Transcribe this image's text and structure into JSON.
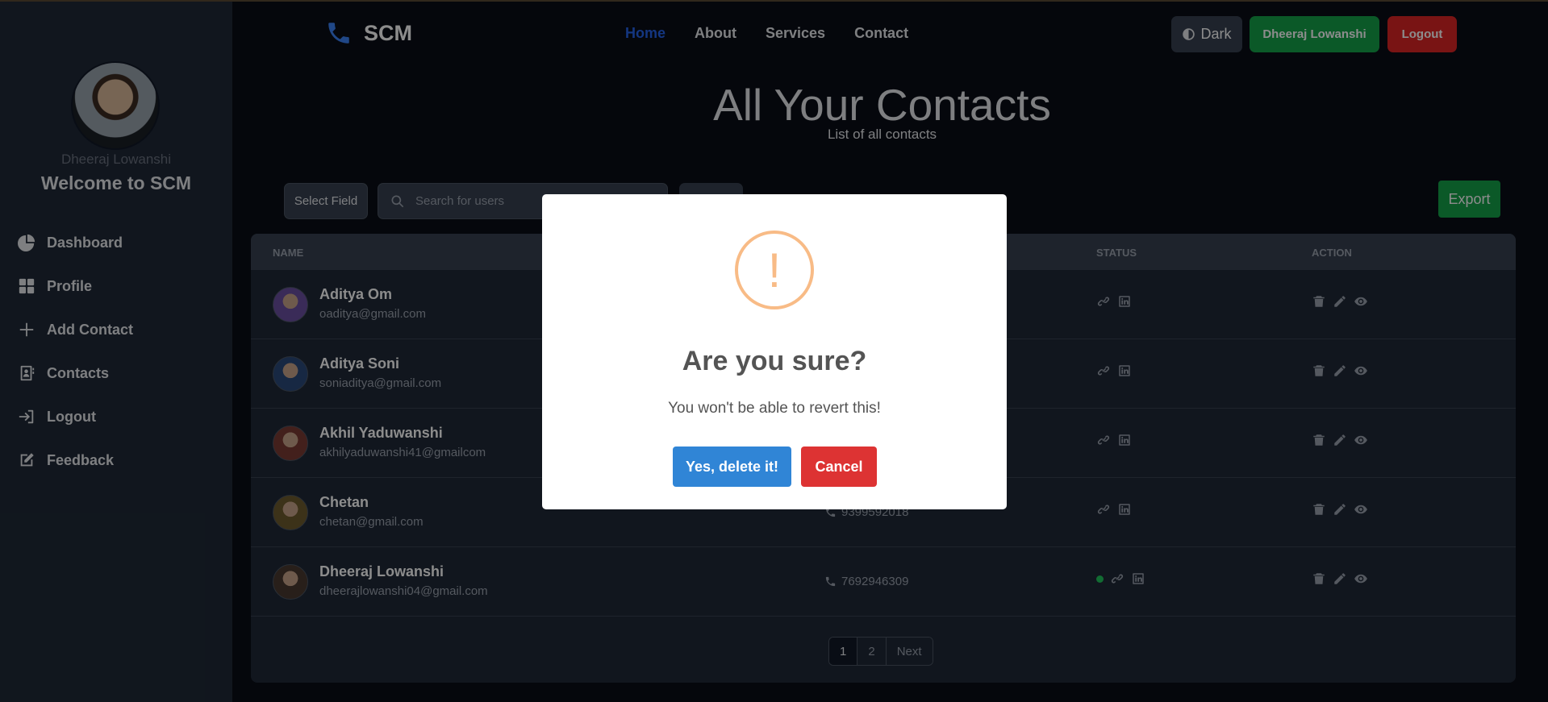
{
  "sidebar": {
    "username": "Dheeraj Lowanshi",
    "welcome": "Welcome to SCM",
    "items": [
      {
        "label": "Dashboard",
        "icon": "pie-chart-icon"
      },
      {
        "label": "Profile",
        "icon": "grid-icon"
      },
      {
        "label": "Add Contact",
        "icon": "plus-icon"
      },
      {
        "label": "Contacts",
        "icon": "address-book-icon"
      },
      {
        "label": "Logout",
        "icon": "sign-in-icon"
      },
      {
        "label": "Feedback",
        "icon": "edit-icon"
      }
    ]
  },
  "navbar": {
    "brand": "SCM",
    "links": [
      "Home",
      "About",
      "Services",
      "Contact"
    ],
    "active": "Home",
    "dark_label": "Dark",
    "user_label": "Dheeraj Lowanshi",
    "logout_label": "Logout"
  },
  "page": {
    "title": "All Your Contacts",
    "subtitle": "List of all contacts"
  },
  "filters": {
    "select_label": "Select Field",
    "search_placeholder": "Search for users",
    "export_label": "Export"
  },
  "table": {
    "headers": {
      "name": "NAME",
      "status": "STATUS",
      "action": "ACTION"
    },
    "rows": [
      {
        "name": "Aditya Om",
        "email": "oaditya@gmail.com",
        "phone": "",
        "favorite": false,
        "avatar_color": "#6b4fa0"
      },
      {
        "name": "Aditya Soni",
        "email": "soniaditya@gmail.com",
        "phone": "",
        "favorite": false,
        "avatar_color": "#2b4a7a"
      },
      {
        "name": "Akhil Yaduwanshi",
        "email": "akhilyaduwanshi41@gmailcom",
        "phone": "",
        "favorite": false,
        "avatar_color": "#7a3b34"
      },
      {
        "name": "Chetan",
        "email": "chetan@gmail.com",
        "phone": "9399592018",
        "favorite": false,
        "avatar_color": "#6e5b2e"
      },
      {
        "name": "Dheeraj Lowanshi",
        "email": "dheerajlowanshi04@gmail.com",
        "phone": "7692946309",
        "favorite": true,
        "avatar_color": "#4a3a30"
      }
    ]
  },
  "pagination": {
    "pages": [
      "1",
      "2"
    ],
    "next": "Next",
    "current": "1"
  },
  "modal": {
    "icon": "!",
    "title": "Are you sure?",
    "text": "You won't be able to revert this!",
    "confirm": "Yes, delete it!",
    "cancel": "Cancel",
    "colors": {
      "warning": "#f8bb86",
      "confirm": "#3085d6",
      "cancel": "#dd3333"
    }
  }
}
